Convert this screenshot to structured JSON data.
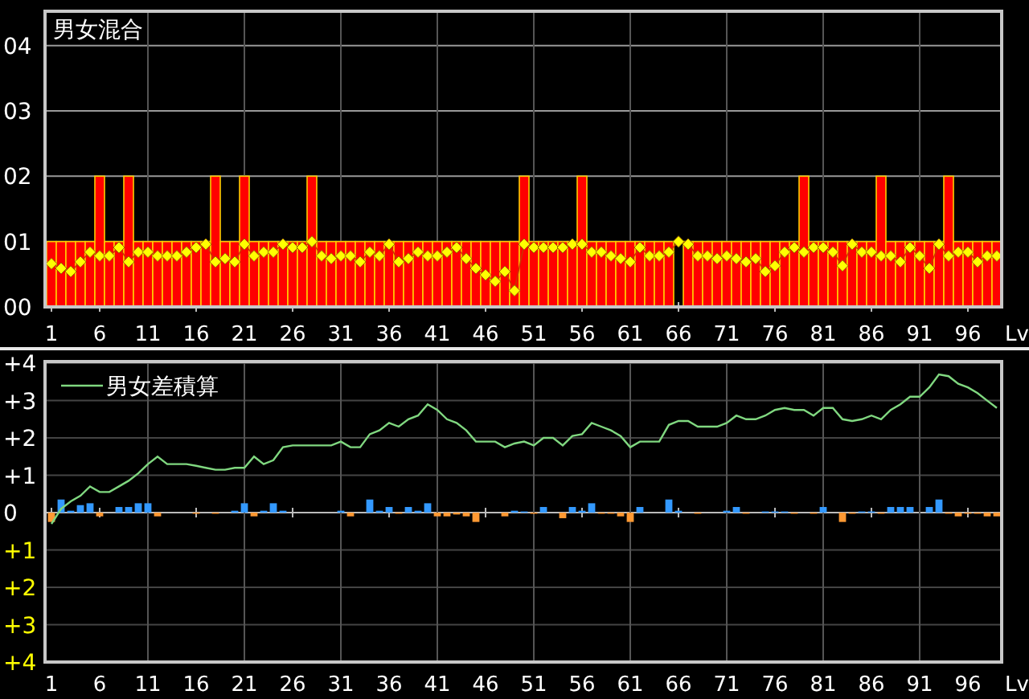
{
  "charts": [
    {
      "chart_data": {
        "type": "bar",
        "title": "男女混合",
        "xlabel": "Lv",
        "xlim": [
          0.5,
          99.5
        ],
        "ylim": [
          0,
          4.5
        ],
        "grid": true,
        "yticks": [
          {
            "value": 0,
            "label": "00"
          },
          {
            "value": 1,
            "label": "01"
          },
          {
            "value": 2,
            "label": "02"
          },
          {
            "value": 3,
            "label": "03"
          },
          {
            "value": 4,
            "label": "04"
          }
        ],
        "xticks": [
          1,
          6,
          11,
          16,
          21,
          26,
          31,
          36,
          41,
          46,
          51,
          56,
          61,
          66,
          71,
          76,
          81,
          86,
          91,
          96
        ],
        "x": [
          1,
          2,
          3,
          4,
          5,
          6,
          7,
          8,
          9,
          10,
          11,
          12,
          13,
          14,
          15,
          16,
          17,
          18,
          19,
          20,
          21,
          22,
          23,
          24,
          25,
          26,
          27,
          28,
          29,
          30,
          31,
          32,
          33,
          34,
          35,
          36,
          37,
          38,
          39,
          40,
          41,
          42,
          43,
          44,
          45,
          46,
          47,
          48,
          49,
          50,
          51,
          52,
          53,
          54,
          55,
          56,
          57,
          58,
          59,
          60,
          61,
          62,
          63,
          64,
          65,
          66,
          67,
          68,
          69,
          70,
          71,
          72,
          73,
          74,
          75,
          76,
          77,
          78,
          79,
          80,
          81,
          82,
          83,
          84,
          85,
          86,
          87,
          88,
          89,
          90,
          91,
          92,
          93,
          94,
          95,
          96,
          97,
          98,
          99
        ],
        "series": [
          {
            "type": "bar",
            "color": "#ff0000",
            "values": [
              1,
              1,
              1,
              1,
              1,
              2,
              1,
              1,
              2,
              1,
              1,
              1,
              1,
              1,
              1,
              1,
              1,
              2,
              1,
              1,
              2,
              1,
              1,
              1,
              1,
              1,
              1,
              2,
              1,
              1,
              1,
              1,
              1,
              1,
              1,
              1,
              1,
              1,
              1,
              1,
              1,
              1,
              1,
              1,
              1,
              1,
              1,
              1,
              1,
              2,
              1,
              1,
              1,
              1,
              1,
              2,
              1,
              1,
              1,
              1,
              1,
              1,
              1,
              1,
              1,
              0,
              1,
              1,
              1,
              1,
              1,
              1,
              1,
              1,
              1,
              1,
              1,
              1,
              2,
              1,
              1,
              1,
              1,
              1,
              1,
              1,
              2,
              1,
              1,
              1,
              1,
              1,
              1,
              2,
              1,
              1,
              1,
              1,
              1
            ]
          },
          {
            "type": "line",
            "color": "#ffff00",
            "marker": "diamond",
            "values": [
              0.66,
              0.59,
              0.54,
              0.69,
              0.84,
              0.78,
              0.78,
              0.91,
              0.69,
              0.84,
              0.84,
              0.78,
              0.78,
              0.78,
              0.84,
              0.91,
              0.96,
              0.69,
              0.74,
              0.69,
              0.96,
              0.78,
              0.84,
              0.84,
              0.96,
              0.91,
              0.91,
              1.0,
              0.78,
              0.74,
              0.78,
              0.78,
              0.69,
              0.84,
              0.78,
              0.96,
              0.69,
              0.74,
              0.84,
              0.78,
              0.78,
              0.84,
              0.91,
              0.74,
              0.59,
              0.49,
              0.39,
              0.54,
              0.25,
              0.96,
              0.91,
              0.91,
              0.91,
              0.91,
              0.96,
              0.96,
              0.84,
              0.84,
              0.78,
              0.74,
              0.69,
              0.91,
              0.78,
              0.78,
              0.84,
              1.0,
              0.96,
              0.78,
              0.78,
              0.74,
              0.78,
              0.74,
              0.69,
              0.74,
              0.54,
              0.63,
              0.84,
              0.91,
              0.84,
              0.91,
              0.91,
              0.84,
              0.63,
              0.96,
              0.84,
              0.84,
              0.78,
              0.78,
              0.69,
              0.91,
              0.78,
              0.59,
              0.96,
              0.78,
              0.84,
              0.84,
              0.69,
              0.78,
              0.78
            ]
          }
        ]
      }
    },
    {
      "chart_data": {
        "type": "bar",
        "xlabel": "Lv",
        "xlim": [
          0.5,
          99.5
        ],
        "ylim": [
          -4,
          4
        ],
        "grid": true,
        "yticks": [
          {
            "value": 4,
            "label": "+4"
          },
          {
            "value": 3,
            "label": "+3"
          },
          {
            "value": 2,
            "label": "+2"
          },
          {
            "value": 1,
            "label": "+1"
          },
          {
            "value": 0,
            "label": "0"
          },
          {
            "value": -1,
            "label": "+1"
          },
          {
            "value": -2,
            "label": "+2"
          },
          {
            "value": -3,
            "label": "+3"
          },
          {
            "value": -4,
            "label": "+4"
          }
        ],
        "xticks": [
          1,
          6,
          11,
          16,
          21,
          26,
          31,
          36,
          41,
          46,
          51,
          56,
          61,
          66,
          71,
          76,
          81,
          86,
          91,
          96
        ],
        "x": [
          1,
          2,
          3,
          4,
          5,
          6,
          7,
          8,
          9,
          10,
          11,
          12,
          13,
          14,
          15,
          16,
          17,
          18,
          19,
          20,
          21,
          22,
          23,
          24,
          25,
          26,
          27,
          28,
          29,
          30,
          31,
          32,
          33,
          34,
          35,
          36,
          37,
          38,
          39,
          40,
          41,
          42,
          43,
          44,
          45,
          46,
          47,
          48,
          49,
          50,
          51,
          52,
          53,
          54,
          55,
          56,
          57,
          58,
          59,
          60,
          61,
          62,
          63,
          64,
          65,
          66,
          67,
          68,
          69,
          70,
          71,
          72,
          73,
          74,
          75,
          76,
          77,
          78,
          79,
          80,
          81,
          82,
          83,
          84,
          85,
          86,
          87,
          88,
          89,
          90,
          91,
          92,
          93,
          94,
          95,
          96,
          97,
          98,
          99
        ],
        "series": [
          {
            "type": "bar",
            "color": "#3399ff",
            "values": [
              null,
              0.35,
              0.05,
              0.2,
              0.25,
              null,
              null,
              0.15,
              0.15,
              0.25,
              0.25,
              null,
              null,
              null,
              null,
              null,
              null,
              null,
              null,
              0.05,
              0.25,
              null,
              0.05,
              0.25,
              0.05,
              null,
              null,
              null,
              null,
              null,
              0.05,
              null,
              null,
              0.35,
              0.05,
              0.15,
              null,
              0.15,
              0.05,
              0.25,
              null,
              null,
              null,
              null,
              null,
              null,
              null,
              null,
              0.05,
              0.03,
              null,
              0.15,
              null,
              null,
              0.15,
              0.05,
              0.25,
              null,
              null,
              null,
              null,
              0.15,
              null,
              null,
              0.35,
              0.05,
              null,
              null,
              null,
              null,
              0.05,
              0.15,
              null,
              null,
              0.03,
              0.03,
              0.03,
              null,
              null,
              null,
              0.15,
              null,
              null,
              null,
              0.03,
              0.03,
              null,
              0.15,
              0.15,
              0.15,
              null,
              0.15,
              0.35,
              null,
              null,
              null,
              null,
              null,
              null
            ]
          },
          {
            "type": "bar",
            "color": "#ff9933",
            "values": [
              -0.25,
              null,
              null,
              null,
              null,
              -0.1,
              null,
              null,
              null,
              null,
              null,
              -0.1,
              null,
              null,
              null,
              -0.03,
              null,
              -0.03,
              null,
              null,
              null,
              -0.1,
              null,
              null,
              null,
              null,
              null,
              null,
              null,
              null,
              null,
              -0.1,
              null,
              null,
              null,
              null,
              -0.03,
              null,
              null,
              null,
              -0.1,
              -0.1,
              -0.05,
              -0.1,
              -0.25,
              null,
              null,
              -0.1,
              null,
              null,
              -0.03,
              null,
              null,
              -0.15,
              null,
              null,
              null,
              -0.03,
              -0.03,
              -0.1,
              -0.25,
              null,
              null,
              null,
              null,
              null,
              null,
              -0.03,
              null,
              null,
              null,
              null,
              -0.03,
              null,
              null,
              null,
              null,
              -0.03,
              null,
              -0.03,
              null,
              null,
              -0.25,
              -0.03,
              null,
              null,
              -0.03,
              null,
              null,
              null,
              null,
              null,
              null,
              -0.03,
              -0.1,
              -0.03,
              -0.03,
              -0.1,
              -0.1
            ]
          },
          {
            "type": "line",
            "name": "男女差積算",
            "color": "#80d880",
            "values": [
              -0.3,
              0.1,
              0.3,
              0.45,
              0.7,
              0.55,
              0.55,
              0.7,
              0.85,
              1.05,
              1.3,
              1.5,
              1.3,
              1.3,
              1.3,
              1.25,
              1.2,
              1.15,
              1.15,
              1.2,
              1.2,
              1.5,
              1.3,
              1.4,
              1.75,
              1.8,
              1.8,
              1.8,
              1.8,
              1.8,
              1.9,
              1.75,
              1.75,
              2.1,
              2.2,
              2.4,
              2.3,
              2.5,
              2.6,
              2.9,
              2.75,
              2.5,
              2.4,
              2.2,
              1.9,
              1.9,
              1.9,
              1.75,
              1.85,
              1.9,
              1.8,
              2.0,
              2.0,
              1.8,
              2.05,
              2.1,
              2.4,
              2.3,
              2.2,
              2.05,
              1.75,
              1.9,
              1.9,
              1.9,
              2.35,
              2.45,
              2.45,
              2.3,
              2.3,
              2.3,
              2.4,
              2.6,
              2.5,
              2.5,
              2.6,
              2.75,
              2.8,
              2.75,
              2.75,
              2.6,
              2.8,
              2.8,
              2.5,
              2.45,
              2.5,
              2.6,
              2.5,
              2.75,
              2.9,
              3.1,
              3.1,
              3.35,
              3.7,
              3.65,
              3.45,
              3.35,
              3.2,
              3.0,
              2.8
            ]
          }
        ]
      }
    }
  ]
}
